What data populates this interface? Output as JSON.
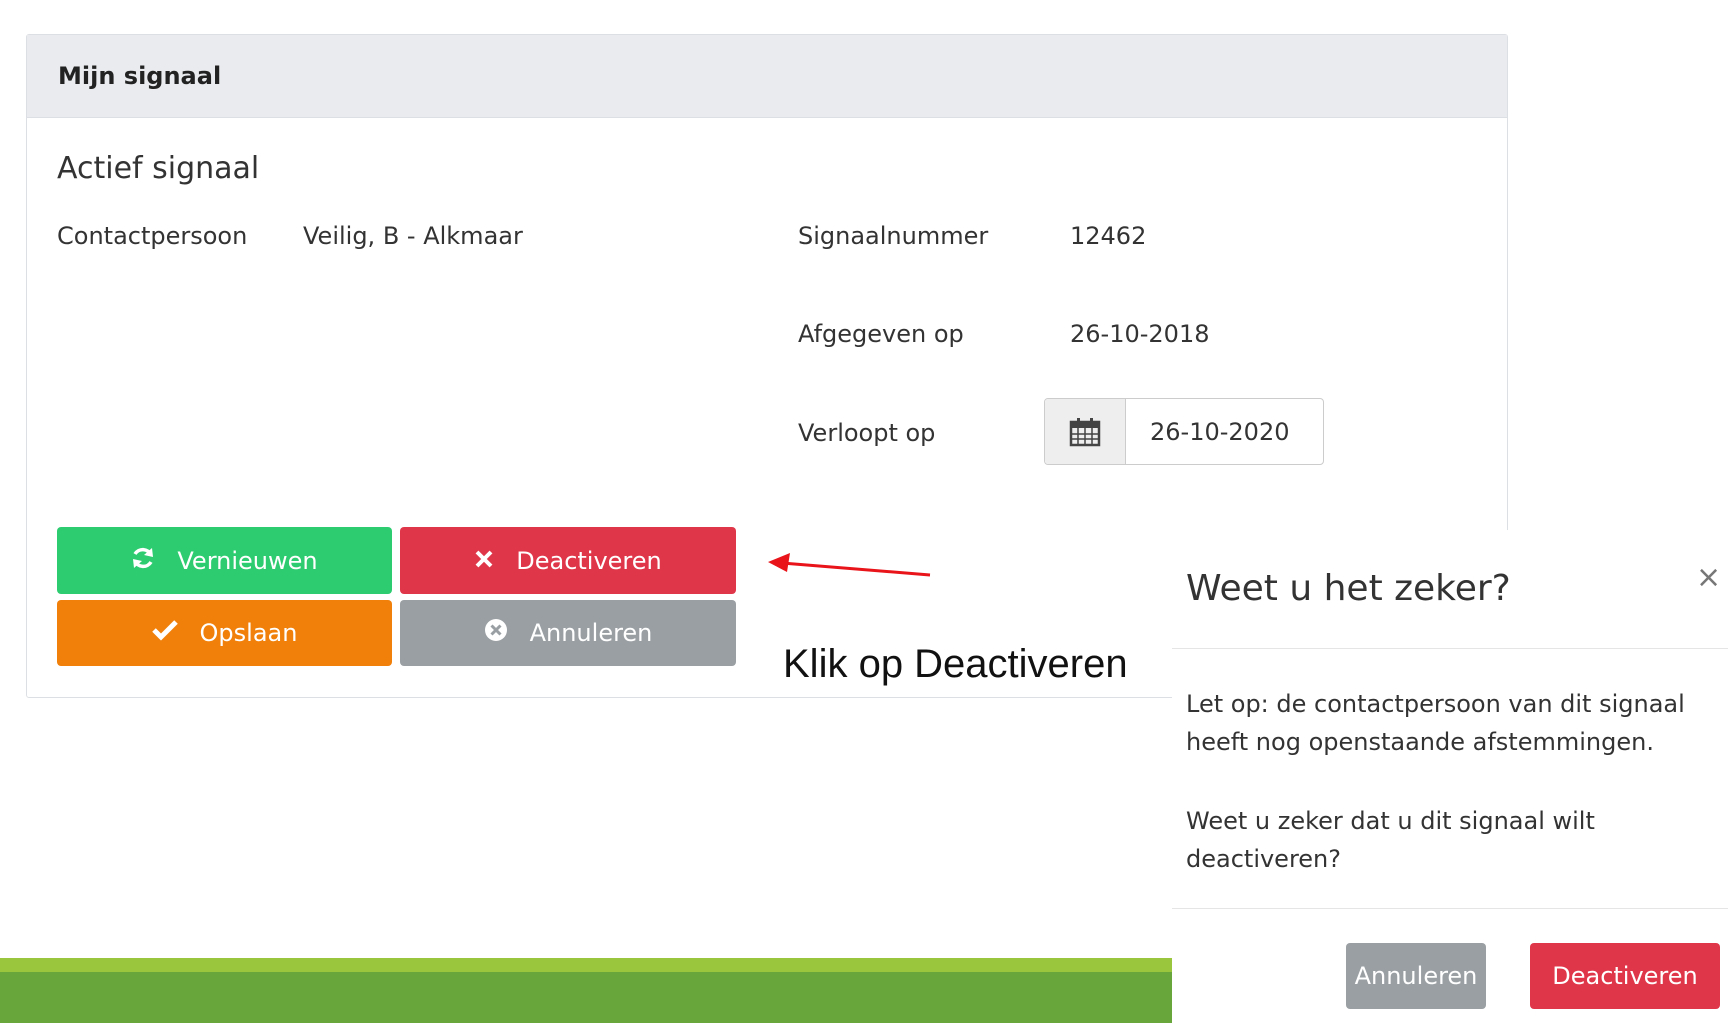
{
  "panel": {
    "title": "Mijn signaal",
    "subtitle": "Actief signaal",
    "contact_label": "Contactpersoon",
    "contact_value": "Veilig, B - Alkmaar",
    "number_label": "Signaalnummer",
    "number_value": "12462",
    "issued_label": "Afgegeven op",
    "issued_value": "26-10-2018",
    "expires_label": "Verloopt op",
    "expires_value": "26-10-2020"
  },
  "buttons": {
    "renew": "Vernieuwen",
    "deactivate": "Deactiveren",
    "save": "Opslaan",
    "cancel": "Annuleren"
  },
  "callout": "Klik op Deactiveren",
  "modal": {
    "title": "Weet u het zeker?",
    "close": "×",
    "warning": "Let op: de contactpersoon van dit signaal heeft nog openstaande afstemmingen.",
    "question": "Weet u zeker dat u dit signaal wilt deactiveren?",
    "cancel": "Annuleren",
    "confirm": "Deactiveren"
  },
  "colors": {
    "green": "#2ecc71",
    "red": "#e0364a",
    "orange": "#f0800a",
    "grey": "#9a9fa3"
  },
  "icons": {
    "renew": "refresh-icon",
    "deactivate": "times-icon",
    "save": "check-icon",
    "cancel": "times-circle-icon",
    "date": "calendar-icon"
  }
}
